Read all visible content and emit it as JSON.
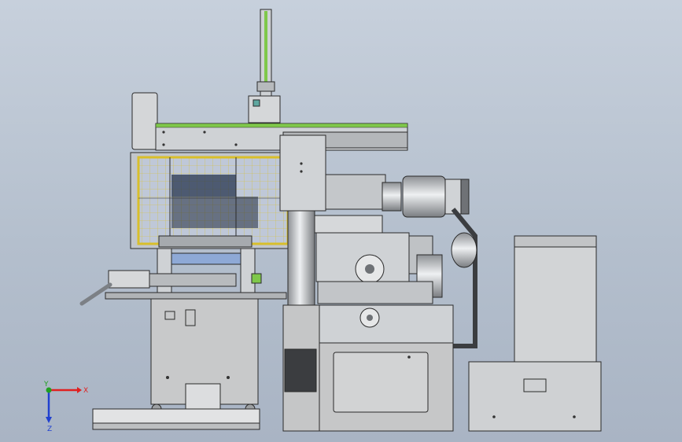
{
  "viewport": {
    "background_top": "#c7d0dc",
    "background_bottom": "#a9b4c4"
  },
  "model": {
    "description_hidden": false,
    "colors": {
      "frame": "#d2d4d6",
      "frame_dark": "#8b8e92",
      "panel": "#b9bcbf",
      "cabinet": "#c6c7c8",
      "guard_yellow": "#d9bf2a",
      "grid_blue": "#3d5a9e",
      "accent_green": "#7fc84a",
      "outline": "#2a2a2a"
    }
  },
  "triad": {
    "x_label": "X",
    "y_label": "Y",
    "z_label": "Z",
    "x_color": "#e02020",
    "y_color": "#20a020",
    "z_color": "#2040d0"
  }
}
